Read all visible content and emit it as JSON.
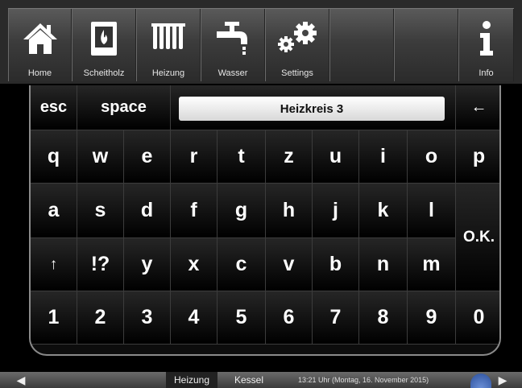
{
  "nav": {
    "home": "Home",
    "scheitholz": "Scheitholz",
    "heizung": "Heizung",
    "wasser": "Wasser",
    "settings": "Settings",
    "info": "Info"
  },
  "keyboard": {
    "esc": "esc",
    "space": "space",
    "input_value": "Heizkreis 3",
    "backspace": "←",
    "row1": [
      "q",
      "w",
      "e",
      "r",
      "t",
      "z",
      "u",
      "i",
      "o",
      "p"
    ],
    "row2": [
      "a",
      "s",
      "d",
      "f",
      "g",
      "h",
      "j",
      "k",
      "l"
    ],
    "row3": [
      "↑",
      "!?",
      "y",
      "x",
      "c",
      "v",
      "b",
      "n",
      "m"
    ],
    "row4": [
      "1",
      "2",
      "3",
      "4",
      "5",
      "6",
      "7",
      "8",
      "9",
      "0"
    ],
    "ok": "O.K."
  },
  "bottom": {
    "prev": "◀",
    "tab_heizung": "Heizung",
    "tab_kessel": "Kessel",
    "status": "13:21 Uhr (Montag, 16. November 2015)",
    "next": "▶"
  },
  "colors": {
    "bar": "#3c3c3c",
    "key": "#111111",
    "border": "#8a8a8a"
  }
}
